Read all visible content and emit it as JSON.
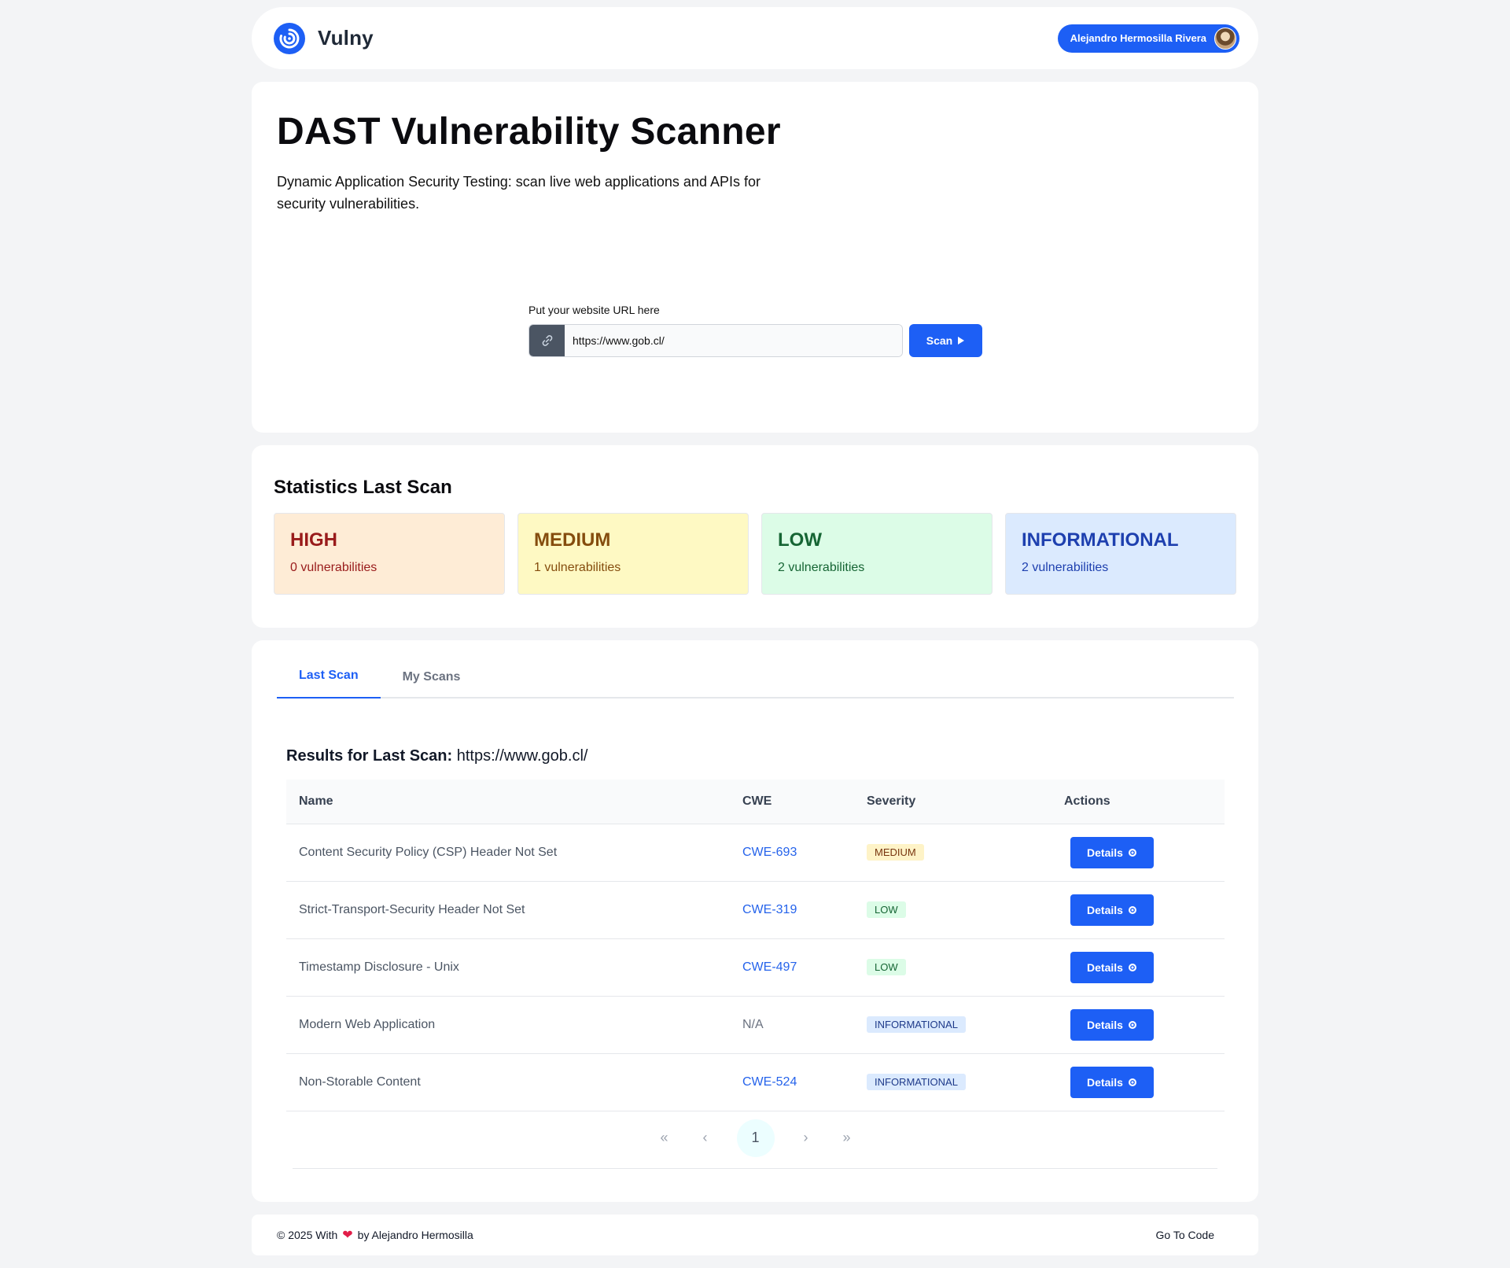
{
  "header": {
    "brand": "Vulny",
    "user_name": "Alejandro Hermosilla Rivera",
    "logo_icon": "spiral-logo-icon",
    "accent": "#1d5ff5"
  },
  "hero": {
    "title": "DAST Vulnerability Scanner",
    "description": "Dynamic Application Security Testing: scan live web applications and APIs for security vulnerabilities.",
    "url_label": "Put your website URL here",
    "url_value": "https://www.gob.cl/",
    "scan_label": "Scan"
  },
  "stats": {
    "title": "Statistics Last Scan",
    "items": [
      {
        "label": "HIGH",
        "count": "0 vulnerabilities",
        "bg": "#feecd6",
        "fg": "#991b1b"
      },
      {
        "label": "MEDIUM",
        "count": "1 vulnerabilities",
        "bg": "#fef9c3",
        "fg": "#854d0e"
      },
      {
        "label": "LOW",
        "count": "2 vulnerabilities",
        "bg": "#dcfce7",
        "fg": "#166534"
      },
      {
        "label": "INFORMATIONAL",
        "count": "2 vulnerabilities",
        "bg": "#dbeafe",
        "fg": "#1e40af"
      }
    ]
  },
  "tabs": [
    "Last Scan",
    "My Scans"
  ],
  "results": {
    "title_prefix": "Results for Last Scan:",
    "title_url": "https://www.gob.cl/",
    "columns": [
      "Name",
      "CWE",
      "Severity",
      "Actions"
    ],
    "details_label": "Details",
    "rows": [
      {
        "name": "Content Security Policy (CSP) Header Not Set",
        "cwe": "CWE-693",
        "severity": "MEDIUM"
      },
      {
        "name": "Strict-Transport-Security Header Not Set",
        "cwe": "CWE-319",
        "severity": "LOW"
      },
      {
        "name": "Timestamp Disclosure - Unix",
        "cwe": "CWE-497",
        "severity": "LOW"
      },
      {
        "name": "Modern Web Application",
        "cwe": "N/A",
        "severity": "INFORMATIONAL"
      },
      {
        "name": "Non-Storable Content",
        "cwe": "CWE-524",
        "severity": "INFORMATIONAL"
      }
    ]
  },
  "pagination": {
    "first": "«",
    "prev": "‹",
    "current": "1",
    "next": "›",
    "last": "»"
  },
  "footer": {
    "copyright": "© 2025 With",
    "by": "by Alejandro Hermosilla",
    "heart": "❤",
    "link": "Go To Code"
  }
}
